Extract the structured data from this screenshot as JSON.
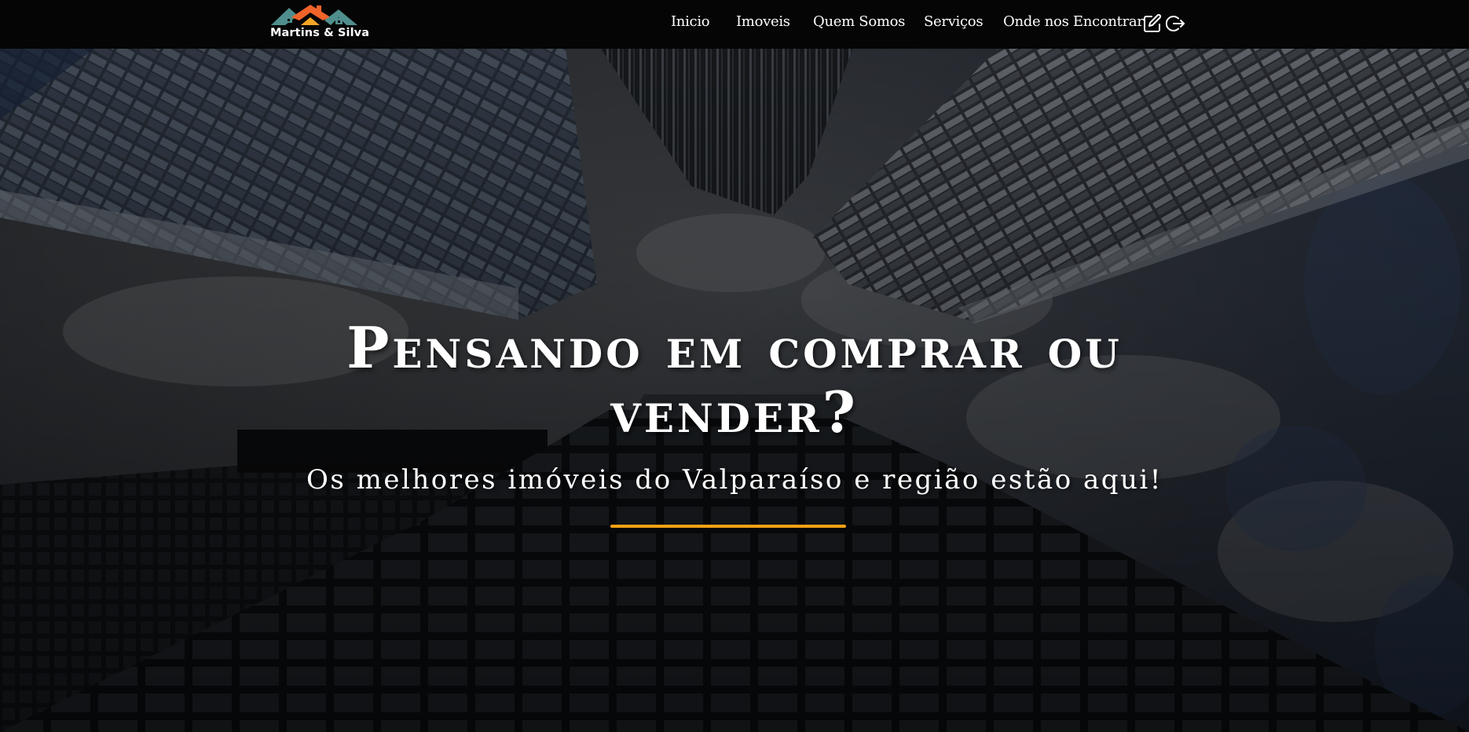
{
  "brand": {
    "name": "Martins & Silva",
    "roof_teal": "#4f8e8c",
    "roof_orange": "#f0632a",
    "roof_yellow": "#f5a524"
  },
  "nav": {
    "items": [
      {
        "label": "Inicio"
      },
      {
        "label": "Imoveis"
      },
      {
        "label": "Quem Somos"
      },
      {
        "label": "Serviços"
      },
      {
        "label": "Onde nos Encontrar"
      }
    ],
    "icons": [
      "edit-icon",
      "logout-icon"
    ]
  },
  "hero": {
    "headline": "Pensando em comprar ou vender?",
    "subheadline": "Os melhores imóveis do Valparaíso e região estão aqui!",
    "accent_color": "#f2a114"
  }
}
